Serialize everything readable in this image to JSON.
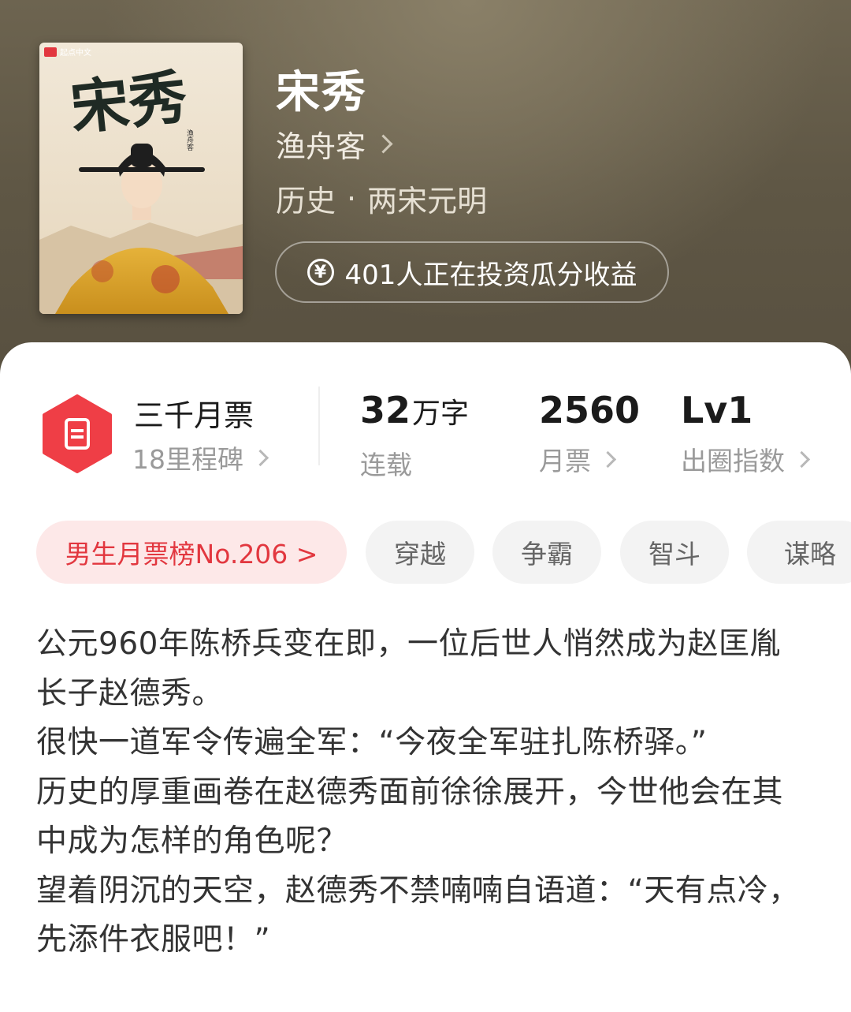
{
  "book": {
    "title": "宋秀",
    "author": "渔舟客",
    "genre": "历史",
    "subgenre": "两宋元明",
    "invest_text": "401人正在投资瓜分收益"
  },
  "cover": {
    "title_art": "宋秀",
    "author_mark": "渔舟客",
    "publisher": "起点中文"
  },
  "stats": {
    "monthly_ticket_title": "三千月票",
    "milestone": "18里程碑",
    "word_count_num": "32",
    "word_count_unit": "万字",
    "status": "连载",
    "tickets_value": "2560",
    "tickets_label": "月票",
    "level_value": "Lv1",
    "level_label": "出圈指数"
  },
  "tags": [
    "男生月票榜No.206 >",
    "穿越",
    "争霸",
    "智斗",
    "谋略"
  ],
  "synopsis": [
    "公元960年陈桥兵变在即，一位后世人悄然成为赵匡胤长子赵德秀。",
    "很快一道军令传遍全军：“今夜全军驻扎陈桥驿。”",
    "历史的厚重画卷在赵德秀面前徐徐展开，今世他会在其中成为怎样的角色呢？",
    "望着阴沉的天空，赵德秀不禁喃喃自语道：“天有点冷，先添件衣服吧！”"
  ],
  "colors": {
    "header_bg": "#5f5745",
    "accent_red": "#e2373f",
    "rank_tag_bg": "#fde8e8",
    "tag_bg": "#f3f3f3"
  },
  "icons": [
    "chevron-right-icon",
    "yen-coin-icon",
    "ticket-badge-icon"
  ]
}
